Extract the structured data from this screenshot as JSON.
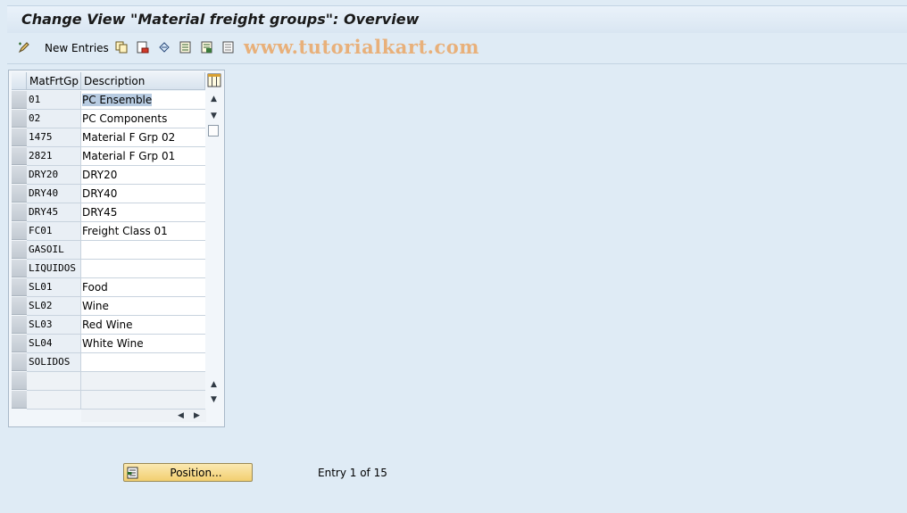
{
  "window": {
    "title": "Change View \"Material freight groups\": Overview"
  },
  "toolbar": {
    "new_entries_label": "New Entries",
    "icons": [
      "change-display-icon",
      "copy-icon",
      "delete-icon",
      "undo-icon",
      "select-all-icon",
      "select-block-icon",
      "deselect-all-icon"
    ]
  },
  "watermark": "www.tutorialkart.com",
  "table": {
    "columns": [
      "MatFrtGp",
      "Description"
    ],
    "rows": [
      {
        "code": "01",
        "desc": "PC Ensemble"
      },
      {
        "code": "02",
        "desc": "PC Components"
      },
      {
        "code": "1475",
        "desc": "Material F Grp 02"
      },
      {
        "code": "2821",
        "desc": "Material F Grp 01"
      },
      {
        "code": "DRY20",
        "desc": "DRY20"
      },
      {
        "code": "DRY40",
        "desc": "DRY40"
      },
      {
        "code": "DRY45",
        "desc": "DRY45"
      },
      {
        "code": "FC01",
        "desc": "Freight Class 01"
      },
      {
        "code": "GASOIL",
        "desc": ""
      },
      {
        "code": "LIQUIDOS",
        "desc": ""
      },
      {
        "code": "SL01",
        "desc": "Food"
      },
      {
        "code": "SL02",
        "desc": "Wine"
      },
      {
        "code": "SL03",
        "desc": "Red Wine"
      },
      {
        "code": "SL04",
        "desc": "White Wine"
      },
      {
        "code": "SOLIDOS",
        "desc": ""
      }
    ]
  },
  "footer": {
    "position_button_label": "Position...",
    "entry_text": "Entry 1 of 15"
  },
  "colors": {
    "background": "#dfebf5",
    "button_yellow": "#f2cf70",
    "selection": "#b7cbe1"
  }
}
